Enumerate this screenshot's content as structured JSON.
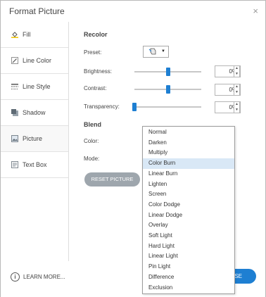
{
  "dialog": {
    "title": "Format Picture",
    "close_glyph": "×"
  },
  "sidebar": {
    "items": [
      {
        "label": "Fill",
        "icon": "fill-bucket-icon"
      },
      {
        "label": "Line Color",
        "icon": "pencil-icon"
      },
      {
        "label": "Line Style",
        "icon": "line-style-icon"
      },
      {
        "label": "Shadow",
        "icon": "shadow-icon"
      },
      {
        "label": "Picture",
        "icon": "picture-icon",
        "active": true
      },
      {
        "label": "Text Box",
        "icon": "text-box-icon"
      }
    ]
  },
  "recolor": {
    "heading": "Recolor",
    "preset_label": "Preset:",
    "preset_icon": "recolor-preset-icon",
    "brightness_label": "Brightness:",
    "brightness_value": "0%",
    "brightness_level": 0.5,
    "contrast_label": "Contrast:",
    "contrast_value": "0%",
    "contrast_level": 0.5,
    "transparency_label": "Transparency:",
    "transparency_value": "0%",
    "transparency_level": 0
  },
  "blend": {
    "heading": "Blend",
    "color_label": "Color:",
    "mode_label": "Mode:"
  },
  "reset_button": "RESET PICTURE",
  "footer": {
    "learn_more": "LEARN MORE...",
    "info_glyph": "i",
    "close_button": "SE"
  },
  "blend_mode_dropdown": {
    "selected": "Color Burn",
    "options": [
      "Normal",
      "Darken",
      "Multiply",
      "Color Burn",
      "Linear Burn",
      "Lighten",
      "Screen",
      "Color Dodge",
      "Linear Dodge",
      "Overlay",
      "Soft Light",
      "Hard Light",
      "Linear Light",
      "Pin Light",
      "Difference",
      "Exclusion"
    ]
  },
  "colors": {
    "accent": "#1e7fd2",
    "reset_button_bg": "#9ea6ad",
    "selected_item_bg": "#d9e8f6"
  }
}
